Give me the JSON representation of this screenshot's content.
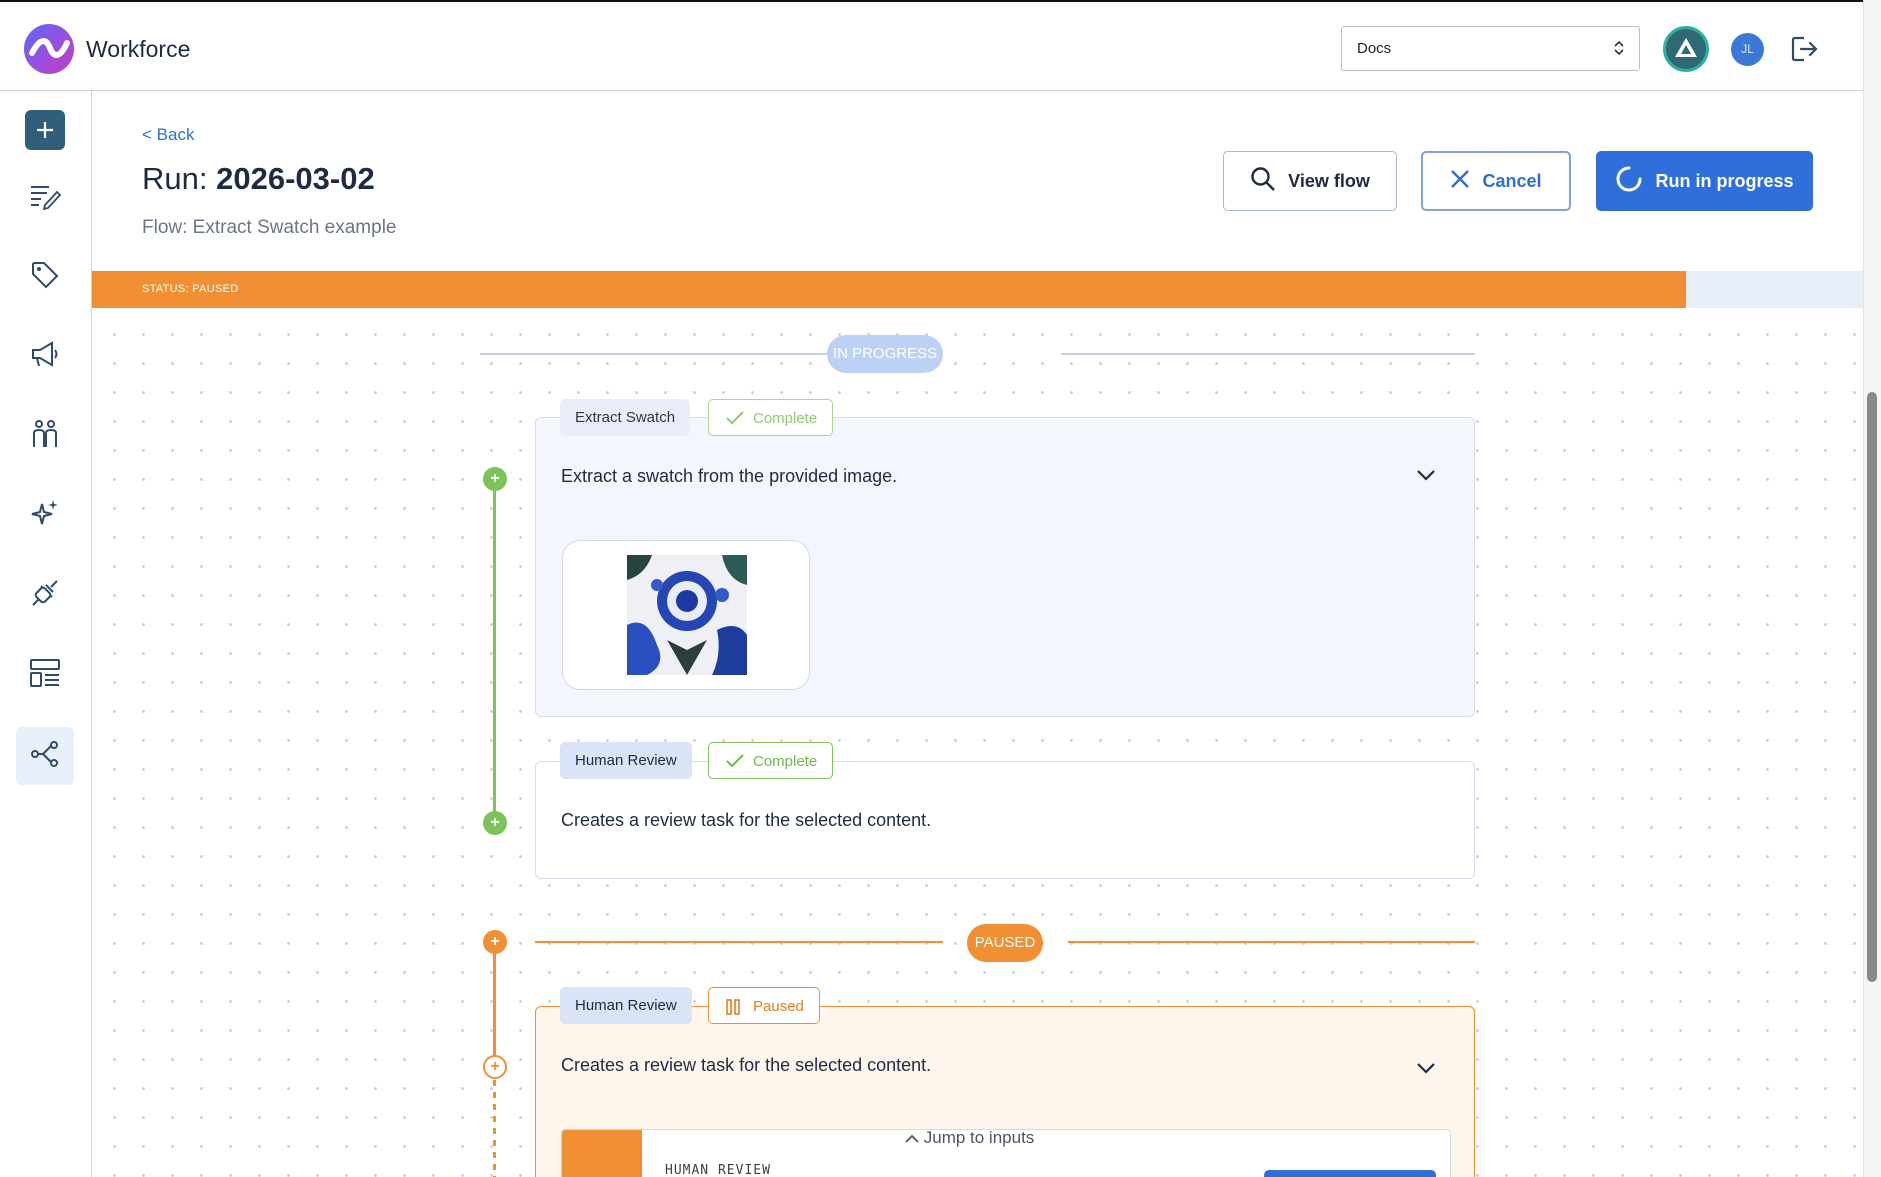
{
  "app": {
    "name": "Workforce"
  },
  "header": {
    "workspace_select": {
      "value": "Docs"
    },
    "user_initials": "JL"
  },
  "page": {
    "back_label": "< Back",
    "title_prefix": "Run:",
    "title_value": "2026-03-02",
    "flow_label": "Flow: Extract Swatch example",
    "buttons": {
      "view_flow": "View flow",
      "cancel": "Cancel",
      "run_status": "Run in progress"
    },
    "status_text": "STATUS: PAUSED",
    "status_progress": 0.9
  },
  "flow": {
    "in_progress_label": "IN PROGRESS",
    "paused_label": "PAUSED",
    "steps": [
      {
        "name": "Extract Swatch",
        "state": "Complete",
        "description": "Extract a swatch from the provided image."
      },
      {
        "name": "Human Review",
        "state": "Complete",
        "description": "Creates a review task for the selected content."
      },
      {
        "name": "Human Review",
        "state": "Paused",
        "description": "Creates a review task for the selected content.",
        "panel_label": "HUMAN REVIEW"
      }
    ],
    "jump_label": "Jump to inputs"
  },
  "colors": {
    "primary": "#2e6fdb",
    "paused": "#f08f34",
    "complete": "#6fb84e"
  }
}
